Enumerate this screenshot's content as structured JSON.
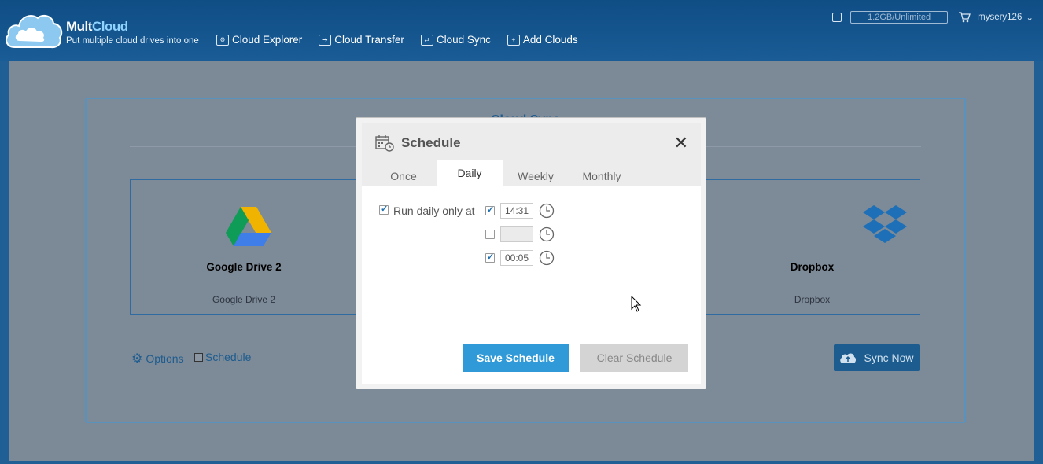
{
  "header": {
    "brand_main": "Mult",
    "brand_accent": "Cloud",
    "tagline": "Put multiple cloud drives into one",
    "nav": [
      {
        "label": "Cloud Explorer",
        "icon": "cloud-explorer-icon"
      },
      {
        "label": "Cloud Transfer",
        "icon": "cloud-transfer-icon"
      },
      {
        "label": "Cloud Sync",
        "icon": "cloud-sync-icon"
      },
      {
        "label": "Add Clouds",
        "icon": "add-clouds-icon"
      }
    ],
    "quota": "1.2GB/Unlimited",
    "username": "mysery126"
  },
  "sync_panel": {
    "title": "Cloud Sync",
    "source": {
      "name": "Google Drive 2",
      "subtitle": "Google Drive 2"
    },
    "target": {
      "name": "Dropbox",
      "subtitle": "Dropbox"
    },
    "options_label": "Options",
    "schedule_label": "Schedule",
    "sync_now_label": "Sync Now"
  },
  "schedule_modal": {
    "title": "Schedule",
    "close_glyph": "✕",
    "tabs": [
      {
        "label": "Once",
        "active": false
      },
      {
        "label": "Daily",
        "active": true
      },
      {
        "label": "Weekly",
        "active": false
      },
      {
        "label": "Monthly",
        "active": false
      }
    ],
    "run_daily_label": "Run daily only at",
    "run_daily_checked": true,
    "times": [
      {
        "checked": true,
        "value": "14:31"
      },
      {
        "checked": false,
        "value": ""
      },
      {
        "checked": true,
        "value": "00:05"
      }
    ],
    "save_label": "Save Schedule",
    "clear_label": "Clear Schedule"
  },
  "colors": {
    "header_bg": "#0f4d85",
    "accent_blue": "#2f9ad7",
    "overlay": "#7c8996"
  }
}
